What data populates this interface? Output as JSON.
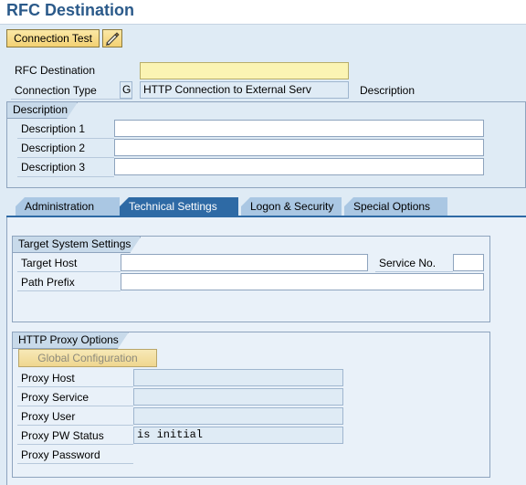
{
  "title": "RFC Destination",
  "toolbar": {
    "connection_test": "Connection Test",
    "icon": "pencil-icon"
  },
  "header": {
    "rfc_destination_label": "RFC Destination",
    "rfc_destination_value": "",
    "connection_type_label": "Connection Type",
    "connection_type_code": "G",
    "connection_type_text": "HTTP Connection to External Serv",
    "description_label": "Description"
  },
  "description": {
    "group_title": "Description",
    "desc1_label": "Description 1",
    "desc2_label": "Description 2",
    "desc3_label": "Description 3",
    "desc1_value": "",
    "desc2_value": "",
    "desc3_value": ""
  },
  "tabs": [
    {
      "label": "Administration"
    },
    {
      "label": "Technical Settings",
      "active": true
    },
    {
      "label": "Logon & Security"
    },
    {
      "label": "Special Options"
    }
  ],
  "target": {
    "group_title": "Target System Settings",
    "target_host_label": "Target Host",
    "target_host_value": "",
    "service_no_label": "Service No.",
    "service_no_value": "",
    "path_prefix_label": "Path Prefix",
    "path_prefix_value": ""
  },
  "proxy": {
    "group_title": "HTTP Proxy Options",
    "global_config_button": "Global Configuration",
    "proxy_host_label": "Proxy Host",
    "proxy_service_label": "Proxy Service",
    "proxy_user_label": "Proxy User",
    "proxy_pw_status_label": "Proxy PW Status",
    "proxy_pw_status_value": "is initial",
    "proxy_password_label": "Proxy Password"
  },
  "colors": {
    "title": "#2b5a8a",
    "tab_active": "#2e6aa5",
    "tab_inactive": "#aac7e3",
    "required_field": "#fbf4b3"
  }
}
